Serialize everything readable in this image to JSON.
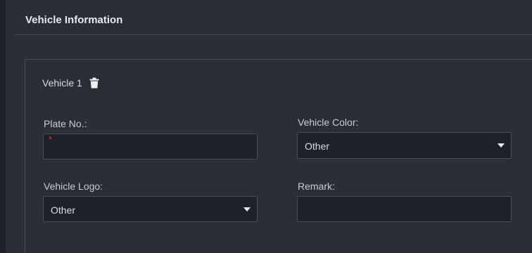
{
  "section": {
    "title": "Vehicle Information"
  },
  "vehicle": {
    "name": "Vehicle 1",
    "delete_icon": "trash-icon"
  },
  "fields": {
    "plate_no": {
      "label": "Plate No.:",
      "value": "",
      "required_mark": "*"
    },
    "vehicle_color": {
      "label": "Vehicle Color:",
      "selected": "Other"
    },
    "vehicle_logo": {
      "label": "Vehicle Logo:",
      "selected": "Other"
    },
    "remark": {
      "label": "Remark:",
      "value": ""
    }
  },
  "colors": {
    "background": "#2b2e37",
    "input_background": "#1f2129",
    "required": "#e0323c"
  }
}
